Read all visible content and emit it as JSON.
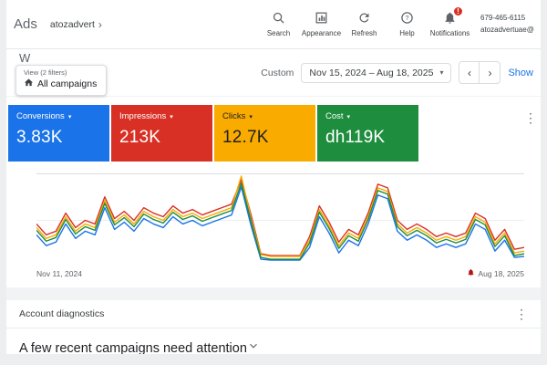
{
  "topbar": {
    "logo": "Ads",
    "account_name": "atozadvert",
    "actions": [
      {
        "id": "search",
        "label": "Search"
      },
      {
        "id": "appearance",
        "label": "Appearance"
      },
      {
        "id": "refresh",
        "label": "Refresh"
      },
      {
        "id": "help",
        "label": "Help"
      },
      {
        "id": "notifications",
        "label": "Notifications",
        "badge": "!"
      }
    ],
    "phone": "679-465-6115",
    "email": "atozadvertuae@"
  },
  "subheader": {
    "partial_heading": "W",
    "filters_chip": {
      "view_label": "View (2 filters)",
      "scope_label": "All campaigns"
    },
    "date_mode_label": "Custom",
    "date_range_label": "Nov 15, 2024 – Aug 18, 2025",
    "show_label": "Show"
  },
  "scorecards": [
    {
      "label": "Conversions",
      "value": "3.83K",
      "bg": "#1a73e8",
      "fg": "#ffffff"
    },
    {
      "label": "Impressions",
      "value": "213K",
      "bg": "#d93025",
      "fg": "#ffffff"
    },
    {
      "label": "Clicks",
      "value": "12.7K",
      "bg": "#f9ab00",
      "fg": "#202124"
    },
    {
      "label": "Cost",
      "value": "dh119K",
      "bg": "#1e8e3e",
      "fg": "#ffffff"
    }
  ],
  "chart_data": {
    "type": "line",
    "x_axis": {
      "start_label": "Nov 11, 2024",
      "end_label": "Aug 18, 2025"
    },
    "ylim": [
      0,
      100
    ],
    "grid": "horizontal",
    "note": "four metric series overlaid on a normalized 0-100 scale",
    "x": [
      0,
      2,
      4,
      6,
      8,
      10,
      12,
      14,
      16,
      18,
      20,
      22,
      24,
      26,
      28,
      30,
      32,
      34,
      36,
      38,
      40,
      42,
      44,
      46,
      48,
      50,
      52,
      54,
      56,
      58,
      60,
      62,
      64,
      66,
      68,
      70,
      72,
      74,
      76,
      78,
      80,
      82,
      84,
      86,
      88,
      90,
      92,
      94,
      96,
      98,
      100
    ],
    "series": [
      {
        "name": "Conversions",
        "color": "#1a73e8",
        "values": [
          33,
          21,
          25,
          45,
          29,
          37,
          33,
          63,
          39,
          47,
          37,
          51,
          45,
          41,
          53,
          45,
          49,
          43,
          47,
          51,
          55,
          86,
          43,
          6,
          5,
          5,
          5,
          5,
          19,
          53,
          35,
          13,
          27,
          21,
          45,
          77,
          73,
          37,
          27,
          33,
          27,
          19,
          23,
          19,
          23,
          45,
          39,
          15,
          27,
          8,
          9
        ]
      },
      {
        "name": "Impressions",
        "color": "#d93025",
        "values": [
          45,
          33,
          37,
          57,
          41,
          49,
          45,
          75,
          51,
          59,
          49,
          63,
          57,
          53,
          65,
          57,
          61,
          55,
          59,
          63,
          67,
          94,
          55,
          12,
          10,
          10,
          10,
          10,
          31,
          65,
          47,
          25,
          39,
          33,
          57,
          89,
          85,
          49,
          39,
          45,
          39,
          31,
          35,
          31,
          35,
          57,
          51,
          27,
          39,
          17,
          19
        ]
      },
      {
        "name": "Clicks",
        "color": "#f9ab00",
        "values": [
          41,
          29,
          33,
          53,
          37,
          45,
          41,
          71,
          47,
          55,
          45,
          59,
          53,
          49,
          61,
          53,
          57,
          51,
          55,
          59,
          63,
          98,
          51,
          11,
          9,
          9,
          9,
          9,
          27,
          61,
          43,
          21,
          35,
          29,
          53,
          85,
          81,
          45,
          35,
          41,
          35,
          27,
          31,
          27,
          31,
          53,
          47,
          23,
          35,
          13,
          15
        ]
      },
      {
        "name": "Cost",
        "color": "#1e8e3e",
        "values": [
          38,
          26,
          30,
          50,
          34,
          42,
          38,
          68,
          44,
          52,
          42,
          56,
          50,
          46,
          58,
          50,
          54,
          48,
          52,
          56,
          60,
          90,
          48,
          8,
          6,
          6,
          6,
          6,
          24,
          58,
          40,
          18,
          32,
          26,
          50,
          82,
          78,
          42,
          32,
          38,
          32,
          24,
          28,
          24,
          28,
          50,
          44,
          20,
          32,
          10,
          12
        ]
      }
    ]
  },
  "diagnostics": {
    "title": "Account diagnostics",
    "alert": "A few recent campaigns need attention"
  }
}
